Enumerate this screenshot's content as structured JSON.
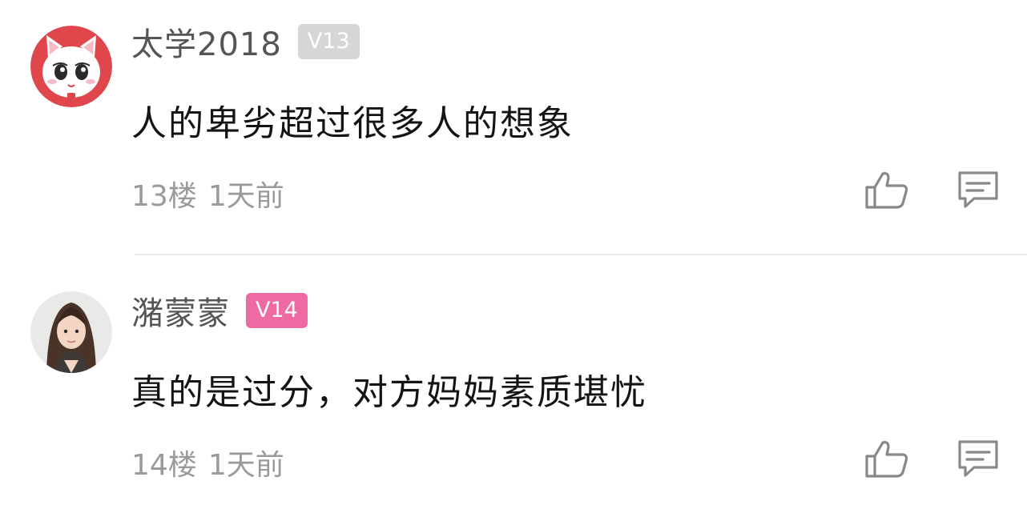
{
  "comments": [
    {
      "username": "太学2018",
      "level_badge": "V13",
      "badge_color": "#d6d6d6",
      "avatar_icon": "pink-cat-avatar",
      "text": "人的卑劣超过很多人的想象",
      "floor": "13楼",
      "time": "1天前"
    },
    {
      "username": "潴蒙蒙",
      "level_badge": "V14",
      "badge_color": "#ee6aa2",
      "avatar_icon": "girl-photo-avatar",
      "text": "真的是过分，对方妈妈素质堪忧",
      "floor": "14楼",
      "time": "1天前"
    }
  ],
  "icons": {
    "like": "thumbs-up-icon",
    "reply": "comment-bubble-icon"
  }
}
